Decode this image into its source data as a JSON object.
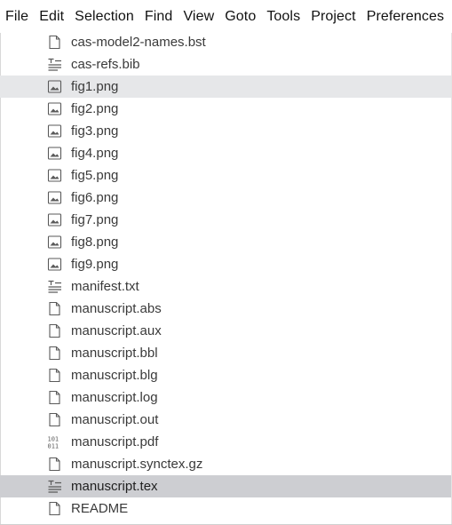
{
  "menu": [
    "File",
    "Edit",
    "Selection",
    "Find",
    "View",
    "Goto",
    "Tools",
    "Project",
    "Preferences"
  ],
  "sidebar": {
    "files": [
      {
        "name": "cas-model2-names.bst",
        "icon": "file-icon",
        "state": "normal"
      },
      {
        "name": "cas-refs.bib",
        "icon": "text-file-icon",
        "state": "normal"
      },
      {
        "name": "fig1.png",
        "icon": "image-file-icon",
        "state": "hover"
      },
      {
        "name": "fig2.png",
        "icon": "image-file-icon",
        "state": "normal"
      },
      {
        "name": "fig3.png",
        "icon": "image-file-icon",
        "state": "normal"
      },
      {
        "name": "fig4.png",
        "icon": "image-file-icon",
        "state": "normal"
      },
      {
        "name": "fig5.png",
        "icon": "image-file-icon",
        "state": "normal"
      },
      {
        "name": "fig6.png",
        "icon": "image-file-icon",
        "state": "normal"
      },
      {
        "name": "fig7.png",
        "icon": "image-file-icon",
        "state": "normal"
      },
      {
        "name": "fig8.png",
        "icon": "image-file-icon",
        "state": "normal"
      },
      {
        "name": "fig9.png",
        "icon": "image-file-icon",
        "state": "normal"
      },
      {
        "name": "manifest.txt",
        "icon": "text-file-icon",
        "state": "normal"
      },
      {
        "name": "manuscript.abs",
        "icon": "file-icon",
        "state": "normal"
      },
      {
        "name": "manuscript.aux",
        "icon": "file-icon",
        "state": "normal"
      },
      {
        "name": "manuscript.bbl",
        "icon": "file-icon",
        "state": "normal"
      },
      {
        "name": "manuscript.blg",
        "icon": "file-icon",
        "state": "normal"
      },
      {
        "name": "manuscript.log",
        "icon": "file-icon",
        "state": "normal"
      },
      {
        "name": "manuscript.out",
        "icon": "file-icon",
        "state": "normal"
      },
      {
        "name": "manuscript.pdf",
        "icon": "binary-file-icon",
        "state": "normal"
      },
      {
        "name": "manuscript.synctex.gz",
        "icon": "file-icon",
        "state": "normal"
      },
      {
        "name": "manuscript.tex",
        "icon": "text-file-icon",
        "state": "selected"
      },
      {
        "name": "README",
        "icon": "file-icon",
        "state": "normal"
      }
    ]
  },
  "colors": {
    "hover_row": "#e6e7e9",
    "selected_row": "#cdced2",
    "icon": "#5a5a5a"
  }
}
